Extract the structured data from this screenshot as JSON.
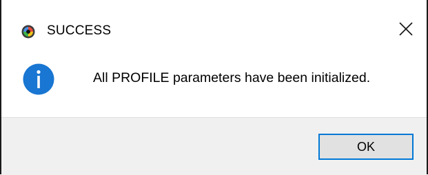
{
  "window": {
    "title": "SUCCESS",
    "app_icon": "app-logo-icon",
    "close_icon": "close-icon"
  },
  "message": {
    "icon": "info-icon",
    "text": "All PROFILE parameters have been initialized."
  },
  "buttons": {
    "ok_label": "OK"
  },
  "colors": {
    "info_blue": "#1976d2",
    "focus_border": "#0078d7",
    "footer_bg": "#f0f0f0",
    "button_bg": "#e1e1e1"
  }
}
